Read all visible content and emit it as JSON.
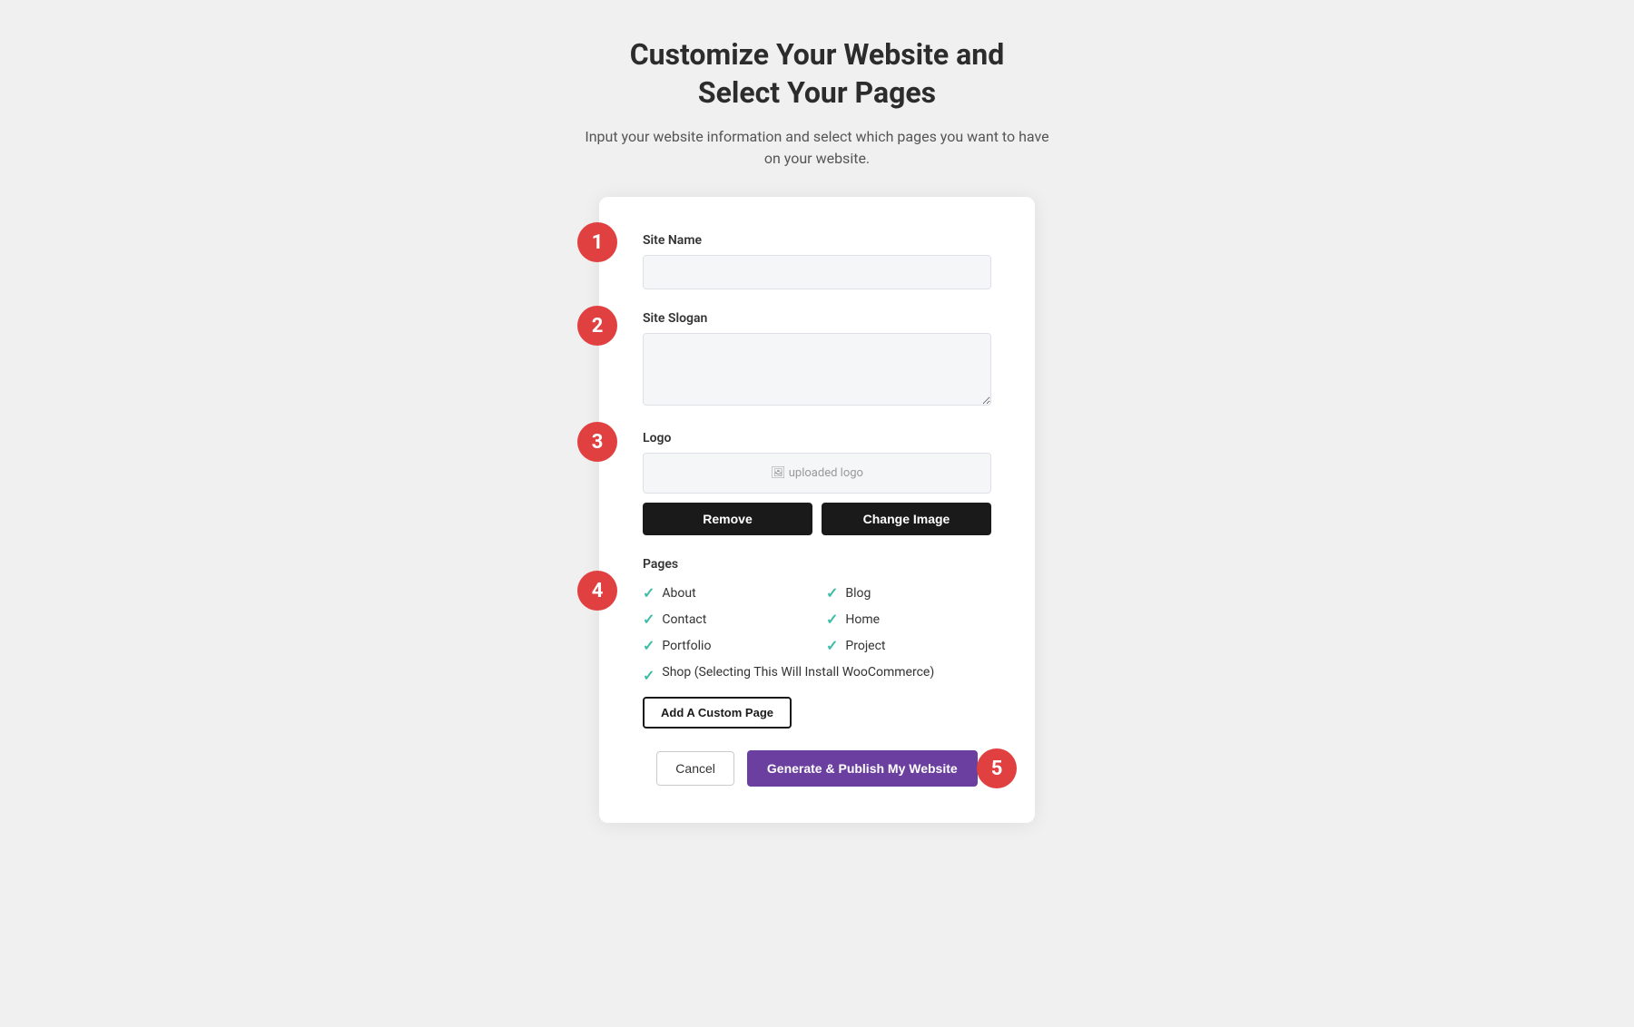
{
  "header": {
    "title": "Customize Your Website and\nSelect Your Pages",
    "subtitle": "Input your website information and select which pages you want to have\non your website."
  },
  "form": {
    "site_name": {
      "label": "Site Name",
      "placeholder": "",
      "value": ""
    },
    "site_slogan": {
      "label": "Site Slogan",
      "placeholder": "",
      "value": ""
    },
    "logo": {
      "label": "Logo",
      "preview_text": "uploaded logo",
      "remove_button": "Remove",
      "change_button": "Change Image"
    },
    "pages": {
      "label": "Pages",
      "items": [
        {
          "name": "About",
          "checked": true,
          "col": 1
        },
        {
          "name": "Blog",
          "checked": true,
          "col": 2
        },
        {
          "name": "Contact",
          "checked": true,
          "col": 1
        },
        {
          "name": "Home",
          "checked": true,
          "col": 2
        },
        {
          "name": "Portfolio",
          "checked": true,
          "col": 1
        },
        {
          "name": "Project",
          "checked": true,
          "col": 2
        }
      ],
      "shop_item": {
        "name": "Shop (Selecting This Will Install WooCommerce)",
        "checked": true
      },
      "add_custom_button": "Add A Custom Page"
    },
    "footer": {
      "cancel_label": "Cancel",
      "submit_label": "Generate & Publish My Website"
    }
  },
  "steps": {
    "step1": "1",
    "step2": "2",
    "step3": "3",
    "step4": "4",
    "step5": "5"
  }
}
